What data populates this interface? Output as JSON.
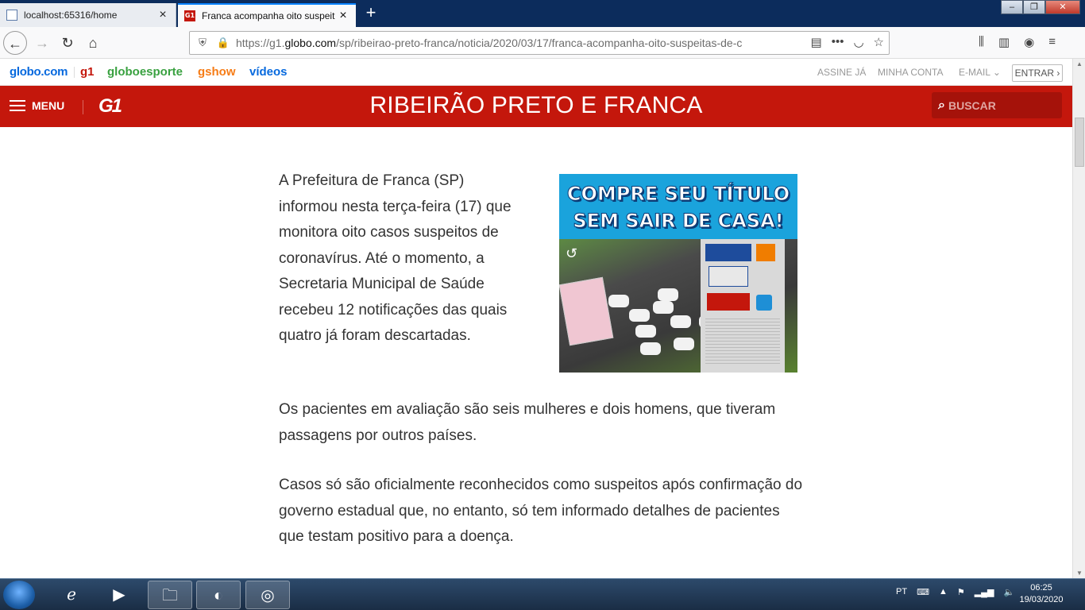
{
  "browser": {
    "tabs": [
      {
        "title": "localhost:65316/home"
      },
      {
        "title": "Franca acompanha oito suspeit"
      }
    ],
    "url_prefix": "https://g1.",
    "url_domain": "globo.com",
    "url_path": "/sp/ribeirao-preto-franca/noticia/2020/03/17/franca-acompanha-oito-suspeitas-de-c"
  },
  "globo_bar": {
    "links": [
      "globo.com",
      "g1",
      "globoesporte",
      "gshow",
      "vídeos"
    ],
    "account": [
      "ASSINE JÁ",
      "MINHA CONTA",
      "E-MAIL"
    ],
    "entrar": "ENTRAR"
  },
  "header": {
    "menu_label": "MENU",
    "logo": "G1",
    "section_title": "RIBEIRÃO PRETO E FRANCA",
    "search_label": "BUSCAR",
    "color": "#c4170c"
  },
  "ad": {
    "line1": "COMPRE SEU TÍTULO",
    "line2": "SEM SAIR DE CASA!"
  },
  "article": {
    "paragraphs": [
      "A Prefeitura de Franca (SP) informou nesta terça-feira (17) que monitora oito casos suspeitos de coronavírus. Até o momento, a Secretaria Municipal de Saúde recebeu 12 notificações das quais quatro já foram descartadas.",
      "Os pacientes em avaliação são seis mulheres e dois homens, que tiveram passagens por outros países.",
      "Casos só são oficialmente reconhecidos como suspeitos após confirmação do governo estadual que, no entanto, só tem informado detalhes de pacientes que testam positivo para a doença."
    ]
  },
  "taskbar": {
    "lang": "PT",
    "time": "06:25",
    "date": "19/03/2020"
  }
}
